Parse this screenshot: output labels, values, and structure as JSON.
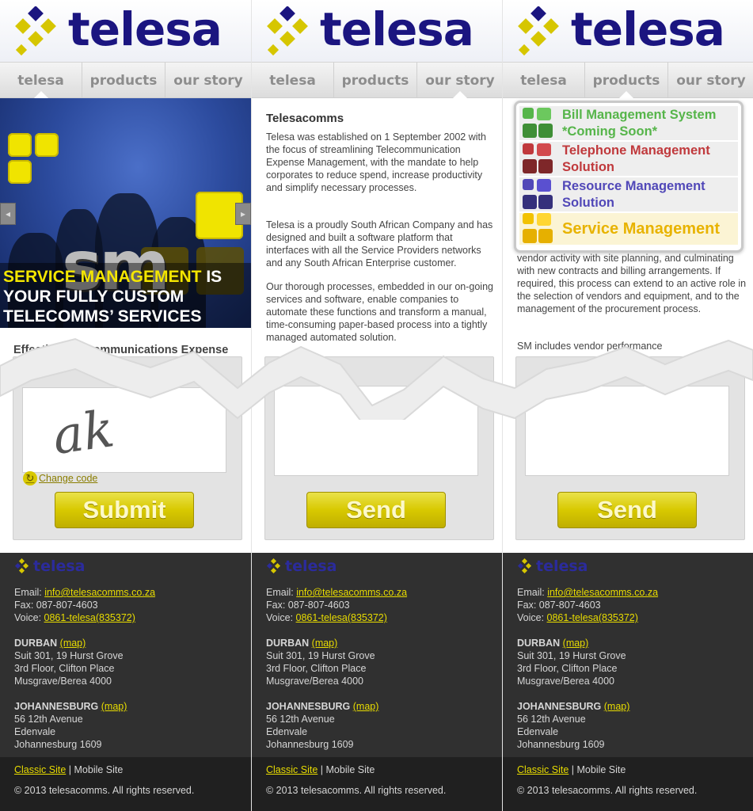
{
  "brand": {
    "name": "telesa",
    "color": "#1b1580",
    "accent": "#e8dc00"
  },
  "nav": {
    "tabs": [
      "telesa",
      "products",
      "our story"
    ]
  },
  "hero": {
    "caption_highlight": "SERVICE MANAGEMENT",
    "caption_is": " IS",
    "caption_line2": "YOUR FULLY CUSTOM",
    "caption_line3": "TELECOMMS’ SERVICES",
    "logo_text": "sm"
  },
  "col1": {
    "intro": "Effective Telecommunications Expense",
    "captcha_text": "ak",
    "change_code": "Change code",
    "submit": "Submit"
  },
  "col2": {
    "title": "Telesacomms",
    "paragraphs": [
      "Telesa was established on 1 September 2002 with the focus of streamlining Telecommunication Expense Management, with the mandate to help corporates to reduce spend, increase productivity and simplify necessary processes.",
      "Telesa is a proudly South African Company and has designed and built a software platform that interfaces with all the Service Providers networks and any South African Enterprise customer.",
      "Our thorough processes, embedded in our on-going services and software, enable companies to automate these functions and transform a manual, time-consuming paper-based process into a tightly managed automated solution."
    ],
    "send": "Send"
  },
  "col3": {
    "menu": [
      {
        "label": "Bill Management System *Coming Soon*",
        "color": "#56b54a"
      },
      {
        "label": "Telephone Management Solution",
        "color": "#c0393c"
      },
      {
        "label": "Resource Management Solution",
        "color": "#5148b8"
      },
      {
        "label": "Service Management",
        "color": "#e8b300"
      }
    ],
    "paragraph": "vendor activity with site planning, and culminating with new contracts and billing arrangements. If required, this process can extend to an active role in the selection of vendors and equipment, and to the management of the procurement process.",
    "partial": "SM includes vendor performance",
    "send": "Send"
  },
  "footer": {
    "logo_word": "telesa",
    "email_label": "Email: ",
    "email": "info@telesacomms.co.za",
    "fax": "Fax: 087-807-4603",
    "voice_label": "Voice: ",
    "voice": "0861-telesa(835372)",
    "durban": "DURBAN",
    "map": "(map)",
    "durban_lines": [
      "Suit 301, 19 Hurst Grove",
      "3rd Floor, Clifton Place",
      "Musgrave/Berea 4000"
    ],
    "johannesburg": "JOHANNESBURG",
    "jhb_lines": [
      "56 12th Avenue",
      "Edenvale",
      "Johannesburg 1609"
    ],
    "classic_site": "Classic Site",
    "separator": " | ",
    "mobile_site": "Mobile Site",
    "copyright": "© 2013 telesacomms. All rights reserved."
  }
}
